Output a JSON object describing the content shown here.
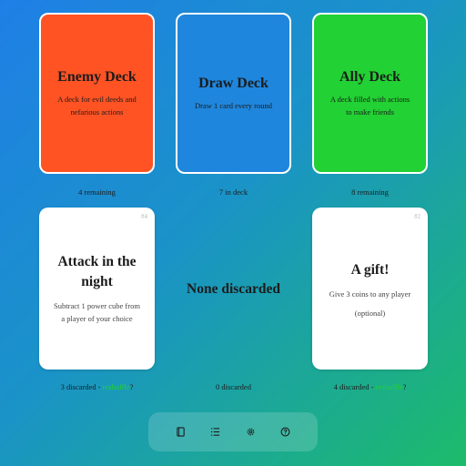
{
  "decks": [
    {
      "title": "Enemy Deck",
      "description": "A deck for evil deeds and nefarious actions",
      "count_label": "4 remaining"
    },
    {
      "title": "Draw Deck",
      "description": "Draw 1 card every round",
      "count_label": "7 in deck"
    },
    {
      "title": "Ally Deck",
      "description": "A deck filled with actions to make friends",
      "count_label": "8 remaining"
    }
  ],
  "discards": {
    "left": {
      "number": "#4",
      "title": "Attack in the night",
      "description": "Subtract 1 power cube from a player of your choice",
      "caption_prefix": "3 discarded - ",
      "caption_link": "reshuffle",
      "caption_suffix": "?"
    },
    "middle": {
      "title": "None discarded",
      "caption": "0 discarded"
    },
    "right": {
      "number": "#2",
      "title": "A gift!",
      "description": "Give 3 coins to any player",
      "extra": "(optional)",
      "caption_prefix": "4 discarded - ",
      "caption_link": "reshuffle",
      "caption_suffix": "?"
    }
  },
  "toolbar": {
    "buttons": [
      "book-icon",
      "list-icon",
      "gear-icon",
      "help-icon"
    ]
  },
  "colors": {
    "enemy": "#ff5324",
    "draw": "#1f86dd",
    "ally": "#22d133",
    "link": "#22d133"
  }
}
